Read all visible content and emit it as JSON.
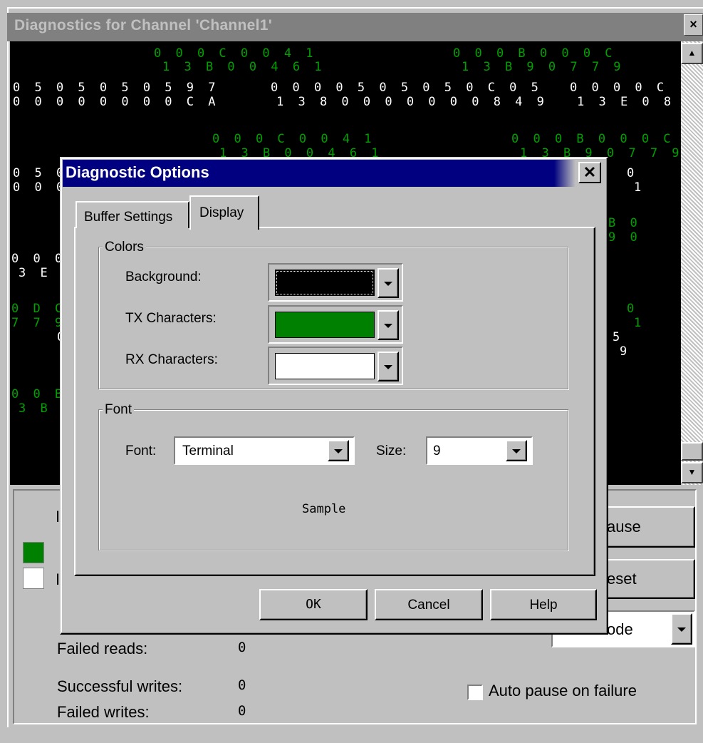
{
  "outer_window": {
    "title": "Diagnostics for Channel 'Channel1'",
    "close_glyph": "×"
  },
  "terminal": {
    "tx_color": "#00a000",
    "rx_color": "#ffffff",
    "lines": [
      {
        "text": "0 0 0 C 0 0 4 1",
        "kind": "tx"
      },
      {
        "text": "1 3 B 0 0 4 6 1",
        "kind": "tx"
      },
      {
        "text": "0 0 0 B 0 0 0 C",
        "kind": "tx"
      },
      {
        "text": "1 3 B 9 0 7 7 9",
        "kind": "tx"
      },
      {
        "text": "0 5 0 5 0 5 0 5 9 7",
        "kind": "rx"
      },
      {
        "text": "0 0 0 0 0 0 0 0 C A",
        "kind": "rx"
      },
      {
        "text": "0 0 0 0 5 0 5 0 5 0 C 0 5",
        "kind": "rx"
      },
      {
        "text": "1 3 8 0 0 0 0 0 0 0 8 4 9",
        "kind": "rx"
      },
      {
        "text": "0 0 0 0 C",
        "kind": "rx"
      },
      {
        "text": "1 3 E 0 8",
        "kind": "rx"
      },
      {
        "text": "0 0 0 C 0 0 4 1",
        "kind": "tx"
      },
      {
        "text": "1 3 B 0 0 4 6 1",
        "kind": "tx"
      },
      {
        "text": "0 0 0 B 0 0 0 C",
        "kind": "tx"
      },
      {
        "text": "1 3 B 9 0 7 7 9",
        "kind": "tx"
      },
      {
        "text": "0 5 0 5",
        "kind": "rx"
      },
      {
        "text": "0 0 0",
        "kind": "rx"
      },
      {
        "text": "0",
        "kind": "rx"
      },
      {
        "text": "1",
        "kind": "rx"
      },
      {
        "text": "B 0",
        "kind": "tx"
      },
      {
        "text": "9 0",
        "kind": "tx"
      },
      {
        "text": "0 0 0",
        "kind": "rx"
      },
      {
        "text": "3 E 0",
        "kind": "rx"
      },
      {
        "text": "0 D C",
        "kind": "tx"
      },
      {
        "text": "7 7 9",
        "kind": "tx"
      },
      {
        "text": "0",
        "kind": "tx"
      },
      {
        "text": "1",
        "kind": "tx"
      },
      {
        "text": "0",
        "kind": "rx"
      },
      {
        "text": "5",
        "kind": "rx"
      },
      {
        "text": "9",
        "kind": "rx"
      },
      {
        "text": "0 0 B",
        "kind": "tx"
      },
      {
        "text": "3 B 9",
        "kind": "tx"
      }
    ]
  },
  "scrollbar": {
    "up_glyph": "▲",
    "down_glyph": "▼"
  },
  "bottom_panel": {
    "swatch_tx_color": "#008000",
    "swatch_rx_color": "#ffffff",
    "stats": [
      {
        "label": "Failed reads:",
        "value": "0"
      },
      {
        "label": "Successful writes:",
        "value": "0"
      },
      {
        "label": "Failed writes:",
        "value": "0"
      }
    ],
    "pause_button_label_fragment": "ause",
    "reset_button_label_fragment": "eset",
    "mode_select_fragment": "ode",
    "auto_pause_label": "Auto pause on failure",
    "auto_pause_checked": false,
    "obscured_left_fragments": [
      "I",
      "I"
    ]
  },
  "dialog": {
    "title": "Diagnostic Options",
    "close_glyph": "✕",
    "tabs": [
      {
        "label": "Buffer Settings",
        "active": false
      },
      {
        "label": "Display",
        "active": true
      }
    ],
    "colors_group": {
      "label": "Colors",
      "rows": [
        {
          "label": "Background:",
          "color": "#000000",
          "focused": true
        },
        {
          "label": "TX Characters:",
          "color": "#008000",
          "focused": false
        },
        {
          "label": "RX Characters:",
          "color": "#ffffff",
          "focused": false
        }
      ]
    },
    "font_group": {
      "label": "Font",
      "font_label": "Font:",
      "font_value": "Terminal",
      "size_label": "Size:",
      "size_value": "9",
      "sample_text": "Sample"
    },
    "buttons": {
      "ok": "OK",
      "cancel": "Cancel",
      "help": "Help"
    }
  }
}
